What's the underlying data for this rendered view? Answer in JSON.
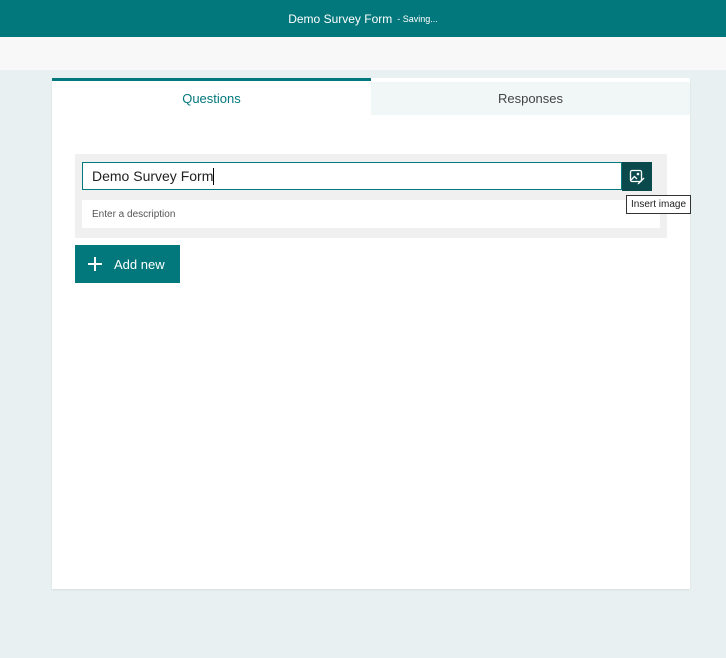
{
  "header": {
    "title": "Demo Survey Form",
    "status": "- Saving..."
  },
  "tabs": [
    {
      "label": "Questions",
      "active": true
    },
    {
      "label": "Responses",
      "active": false
    }
  ],
  "form": {
    "title_value": "Demo Survey Form",
    "description_placeholder": "Enter a description",
    "insert_image_icon": "insert-image-icon",
    "insert_image_tooltip": "Insert image"
  },
  "actions": {
    "add_new_label": "Add new",
    "add_icon": "plus-icon"
  },
  "colors": {
    "accent": "#03787c",
    "insert_image_button": "#0a4a4d",
    "page_background": "#e9f0f2"
  }
}
